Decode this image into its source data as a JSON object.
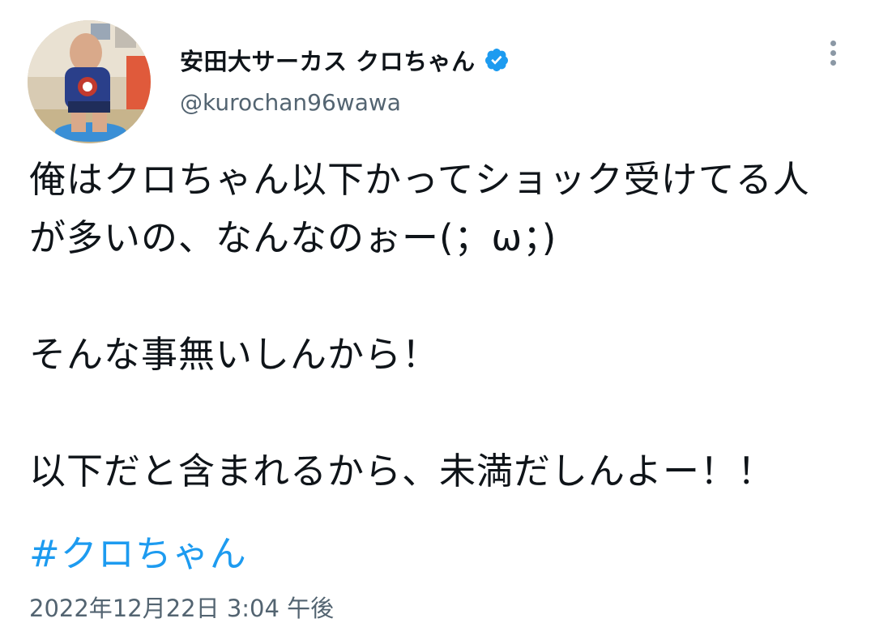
{
  "author": {
    "display_name": "安田大サーカス クロちゃん",
    "handle": "@kurochan96wawa",
    "verified": true
  },
  "tweet": {
    "lines": [
      "俺はクロちゃん以下かってショック受けてる人",
      "が多いの、なんなのぉー(；ω；)",
      "そんな事無いしんから！",
      "以下だと含まれるから、未満だしんよー！！"
    ],
    "hashtag": "#クロちゃん",
    "timestamp": "2022年12月22日 3:04 午後"
  },
  "colors": {
    "accent": "#1d9bf0",
    "secondary_text": "#536471",
    "primary_text": "#0f1419"
  },
  "icons": {
    "verified": "verified-badge-icon",
    "more": "more-options-icon"
  }
}
